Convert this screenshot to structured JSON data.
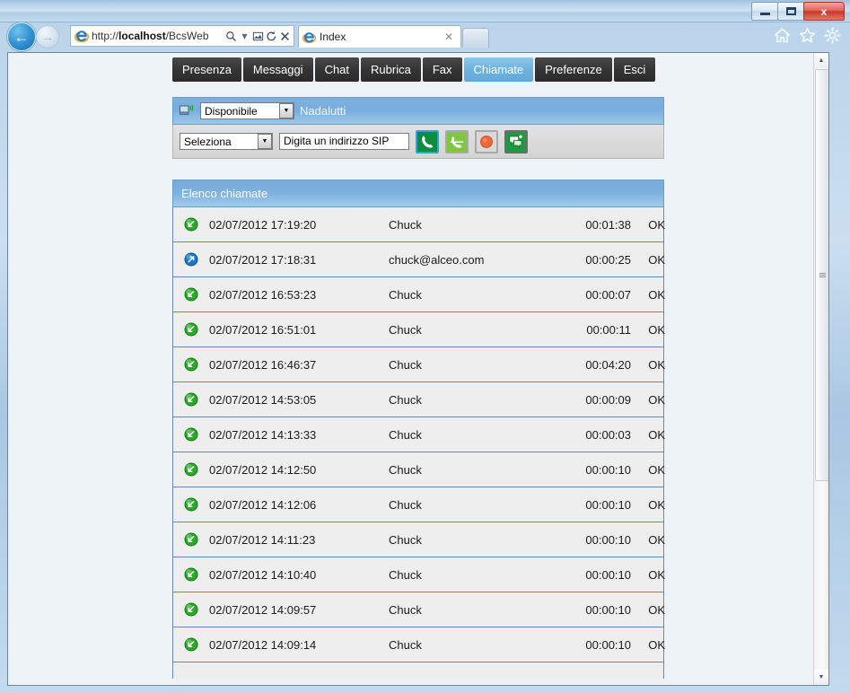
{
  "window": {
    "controls": {
      "minimize_label": "Minimize",
      "maximize_label": "Maximize",
      "close_label": "x"
    }
  },
  "browser": {
    "back_label": "←",
    "forward_label": "→",
    "address": {
      "url_prefix": "http://",
      "url_host": "localhost",
      "url_path": "/BcsWeb",
      "search_icon": "ὐD",
      "dropdown_icon": "▾",
      "compat_icon": "⚇",
      "refresh_icon": "↻",
      "stop_icon": "✕"
    },
    "tab": {
      "title": "Index",
      "close_label": "✕"
    },
    "new_tab_label": "",
    "toolbar_icons": [
      "home-icon",
      "favorites-icon",
      "settings-icon"
    ]
  },
  "app": {
    "tabs": [
      {
        "label": "Presenza",
        "active": false
      },
      {
        "label": "Messaggi",
        "active": false
      },
      {
        "label": "Chat",
        "active": false
      },
      {
        "label": "Rubrica",
        "active": false
      },
      {
        "label": "Fax",
        "active": false
      },
      {
        "label": "Chiamate",
        "active": true
      },
      {
        "label": "Preferenze",
        "active": false
      },
      {
        "label": "Esci",
        "active": false
      }
    ],
    "presence": {
      "status_value": "Disponibile",
      "dropdown_icon": "▼",
      "user_name": "Nadalutti"
    },
    "dialer": {
      "destination_value": "Seleziona",
      "dropdown_icon": "▼",
      "sip_placeholder": "Digita un indirizzo SIP",
      "sip_value": "Digita un indirizzo SIP",
      "buttons": [
        {
          "name": "call-button",
          "icon": "phone-handset-icon"
        },
        {
          "name": "hangup-button",
          "icon": "phone-hangup-icon"
        },
        {
          "name": "record-button",
          "icon": "record-circle-icon"
        },
        {
          "name": "chat-button",
          "icon": "chat-add-icon"
        }
      ]
    },
    "calls": {
      "header": "Elenco chiamate",
      "columns": [
        "direction",
        "datetime",
        "peer",
        "duration",
        "result"
      ],
      "rows": [
        {
          "direction": "incoming",
          "datetime": "02/07/2012 17:19:20",
          "peer": "Chuck",
          "duration": "00:01:38",
          "result": "OK"
        },
        {
          "direction": "outgoing",
          "datetime": "02/07/2012 17:18:31",
          "peer": "chuck@alceo.com",
          "duration": "00:00:25",
          "result": "OK"
        },
        {
          "direction": "incoming",
          "datetime": "02/07/2012 16:53:23",
          "peer": "Chuck",
          "duration": "00:00:07",
          "result": "OK"
        },
        {
          "direction": "incoming",
          "datetime": "02/07/2012 16:51:01",
          "peer": "Chuck",
          "duration": "00:00:11",
          "result": "OK"
        },
        {
          "direction": "incoming",
          "datetime": "02/07/2012 16:46:37",
          "peer": "Chuck",
          "duration": "00:04:20",
          "result": "OK"
        },
        {
          "direction": "incoming",
          "datetime": "02/07/2012 14:53:05",
          "peer": "Chuck",
          "duration": "00:00:09",
          "result": "OK"
        },
        {
          "direction": "incoming",
          "datetime": "02/07/2012 14:13:33",
          "peer": "Chuck",
          "duration": "00:00:03",
          "result": "OK"
        },
        {
          "direction": "incoming",
          "datetime": "02/07/2012 14:12:50",
          "peer": "Chuck",
          "duration": "00:00:10",
          "result": "OK"
        },
        {
          "direction": "incoming",
          "datetime": "02/07/2012 14:12:06",
          "peer": "Chuck",
          "duration": "00:00:10",
          "result": "OK"
        },
        {
          "direction": "incoming",
          "datetime": "02/07/2012 14:11:23",
          "peer": "Chuck",
          "duration": "00:00:10",
          "result": "OK"
        },
        {
          "direction": "incoming",
          "datetime": "02/07/2012 14:10:40",
          "peer": "Chuck",
          "duration": "00:00:10",
          "result": "OK"
        },
        {
          "direction": "incoming",
          "datetime": "02/07/2012 14:09:57",
          "peer": "Chuck",
          "duration": "00:00:10",
          "result": "OK"
        },
        {
          "direction": "incoming",
          "datetime": "02/07/2012 14:09:14",
          "peer": "Chuck",
          "duration": "00:00:10",
          "result": "OK"
        }
      ]
    }
  },
  "scrollbar": {
    "up_icon": "▲",
    "down_icon": "▼"
  },
  "colors": {
    "accent_blue": "#7cb0df",
    "active_tab_blue": "#6db2e0",
    "nav_tab_dark": "#343434",
    "page_background": "#eef3f8",
    "row_background": "#eeeeee",
    "row_border": "#6b87a8",
    "incoming_green": "#2aa92a",
    "outgoing_blue": "#1878c8",
    "close_button_red": "#c83828"
  }
}
